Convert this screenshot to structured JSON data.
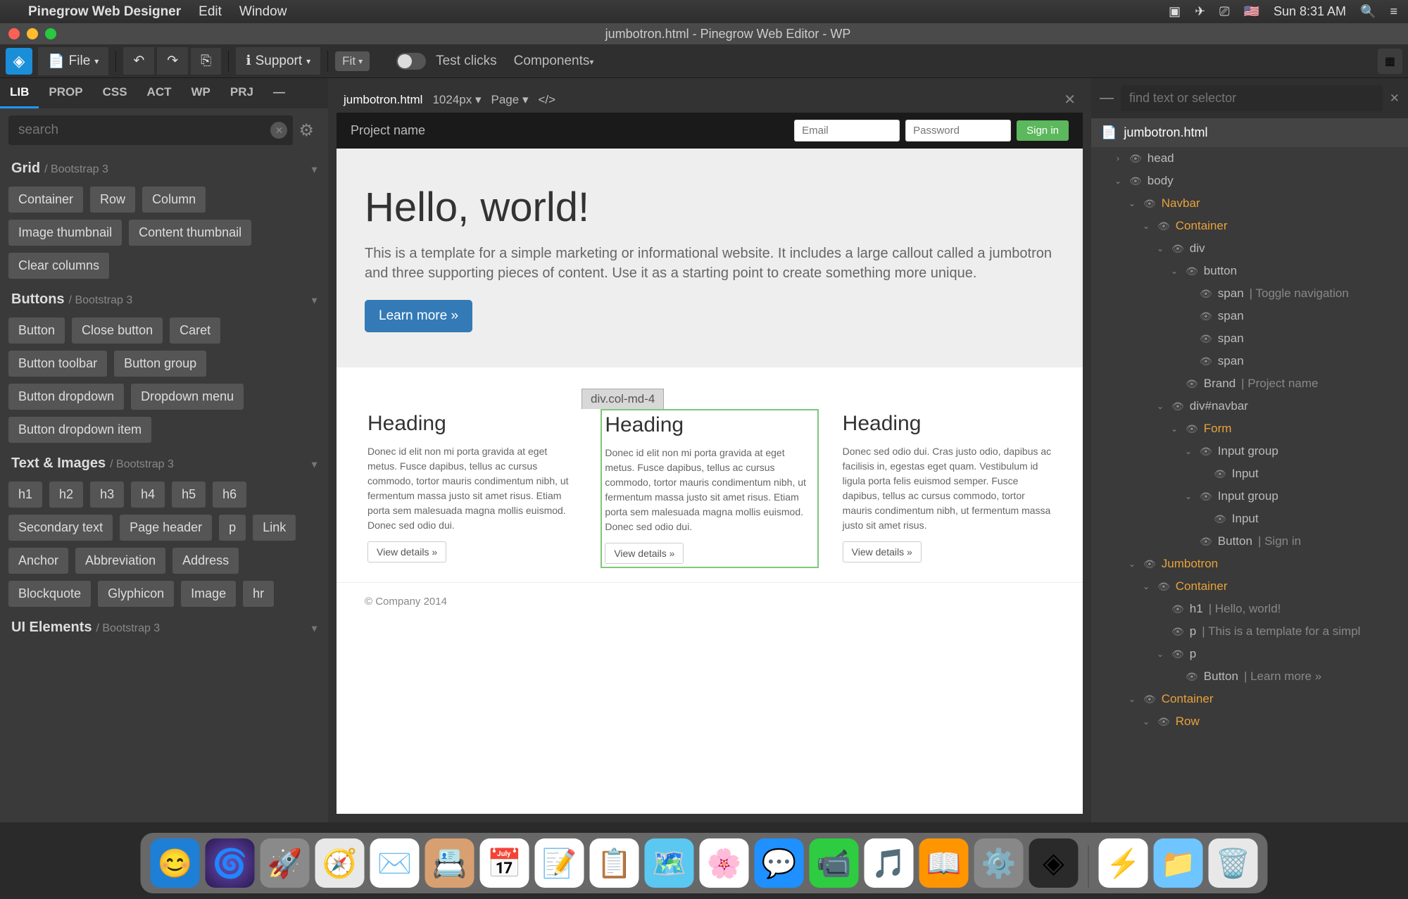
{
  "menubar": {
    "app": "Pinegrow Web Designer",
    "items": [
      "Edit",
      "Window"
    ],
    "clock": "Sun 8:31 AM"
  },
  "window": {
    "title": "jumbotron.html - Pinegrow Web Editor - WP"
  },
  "toolbar": {
    "file": "File",
    "support": "Support",
    "zoom": "Fit",
    "test_clicks": "Test clicks",
    "components": "Components"
  },
  "left": {
    "tabs": [
      "LIB",
      "PROP",
      "CSS",
      "ACT",
      "WP",
      "PRJ",
      "—"
    ],
    "search_placeholder": "search",
    "sections": [
      {
        "title": "Grid",
        "sub": "/ Bootstrap 3",
        "chips": [
          "Container",
          "Row",
          "Column",
          "Image thumbnail",
          "Content thumbnail",
          "Clear columns"
        ]
      },
      {
        "title": "Buttons",
        "sub": "/ Bootstrap 3",
        "chips": [
          "Button",
          "Close button",
          "Caret",
          "Button toolbar",
          "Button group",
          "Button dropdown",
          "Dropdown menu",
          "Button dropdown item"
        ]
      },
      {
        "title": "Text & Images",
        "sub": "/ Bootstrap 3",
        "chips": [
          "h1",
          "h2",
          "h3",
          "h4",
          "h5",
          "h6",
          "Secondary text",
          "Page header",
          "p",
          "Link",
          "Anchor",
          "Abbreviation",
          "Address",
          "Blockquote",
          "Glyphicon",
          "Image",
          "hr"
        ]
      },
      {
        "title": "UI Elements",
        "sub": "/ Bootstrap 3",
        "chips": []
      }
    ]
  },
  "canvas": {
    "file": "jumbotron.html",
    "size": "1024px",
    "page_menu": "Page",
    "selected_tag": "div.col-md-4"
  },
  "preview": {
    "project_name": "Project name",
    "email_ph": "Email",
    "password_ph": "Password",
    "signin": "Sign in",
    "jumbo_h1": "Hello, world!",
    "jumbo_p": "This is a template for a simple marketing or informational website. It includes a large callout called a jumbotron and three supporting pieces of content. Use it as a starting point to create something more unique.",
    "learn_more": "Learn more »",
    "cols": [
      {
        "h": "Heading",
        "p": "Donec id elit non mi porta gravida at eget metus. Fusce dapibus, tellus ac cursus commodo, tortor mauris condimentum nibh, ut fermentum massa justo sit amet risus. Etiam porta sem malesuada magna mollis euismod. Donec sed odio dui.",
        "btn": "View details »"
      },
      {
        "h": "Heading",
        "p": "Donec id elit non mi porta gravida at eget metus. Fusce dapibus, tellus ac cursus commodo, tortor mauris condimentum nibh, ut fermentum massa justo sit amet risus. Etiam porta sem malesuada magna mollis euismod. Donec sed odio dui.",
        "btn": "View details »"
      },
      {
        "h": "Heading",
        "p": "Donec sed odio dui. Cras justo odio, dapibus ac facilisis in, egestas eget quam. Vestibulum id ligula porta felis euismod semper. Fusce dapibus, tellus ac cursus commodo, tortor mauris condimentum nibh, ut fermentum massa justo sit amet risus.",
        "btn": "View details »"
      }
    ],
    "footer": "© Company 2014"
  },
  "tree": {
    "find_ph": "find text or selector",
    "file": "jumbotron.html",
    "rows": [
      {
        "ind": 1,
        "tw": "›",
        "tag": "head",
        "hl": false
      },
      {
        "ind": 1,
        "tw": "⌄",
        "tag": "body",
        "hl": false
      },
      {
        "ind": 2,
        "tw": "⌄",
        "tag": "Navbar",
        "hl": true
      },
      {
        "ind": 3,
        "tw": "⌄",
        "tag": "Container",
        "hl": true
      },
      {
        "ind": 4,
        "tw": "⌄",
        "tag": "div",
        "hl": false
      },
      {
        "ind": 5,
        "tw": "⌄",
        "tag": "button",
        "hl": false
      },
      {
        "ind": 6,
        "tw": "",
        "tag": "span",
        "hl": false,
        "extra": "| Toggle navigation"
      },
      {
        "ind": 6,
        "tw": "",
        "tag": "span",
        "hl": false
      },
      {
        "ind": 6,
        "tw": "",
        "tag": "span",
        "hl": false
      },
      {
        "ind": 6,
        "tw": "",
        "tag": "span",
        "hl": false
      },
      {
        "ind": 5,
        "tw": "",
        "tag": "Brand",
        "hl": false,
        "extra": "| Project name"
      },
      {
        "ind": 4,
        "tw": "⌄",
        "tag": "div#navbar",
        "hl": false
      },
      {
        "ind": 5,
        "tw": "⌄",
        "tag": "Form",
        "hl": true
      },
      {
        "ind": 6,
        "tw": "⌄",
        "tag": "Input group",
        "hl": false
      },
      {
        "ind": 7,
        "tw": "",
        "tag": "Input",
        "hl": false
      },
      {
        "ind": 6,
        "tw": "⌄",
        "tag": "Input group",
        "hl": false
      },
      {
        "ind": 7,
        "tw": "",
        "tag": "Input",
        "hl": false
      },
      {
        "ind": 6,
        "tw": "",
        "tag": "Button",
        "hl": false,
        "extra": "| Sign in"
      },
      {
        "ind": 2,
        "tw": "⌄",
        "tag": "Jumbotron",
        "hl": true
      },
      {
        "ind": 3,
        "tw": "⌄",
        "tag": "Container",
        "hl": true
      },
      {
        "ind": 4,
        "tw": "",
        "tag": "h1",
        "hl": false,
        "extra": "| Hello, world!"
      },
      {
        "ind": 4,
        "tw": "",
        "tag": "p",
        "hl": false,
        "extra": "| This is a template for a simpl"
      },
      {
        "ind": 4,
        "tw": "⌄",
        "tag": "p",
        "hl": false
      },
      {
        "ind": 5,
        "tw": "",
        "tag": "Button",
        "hl": false,
        "extra": "| Learn more »"
      },
      {
        "ind": 2,
        "tw": "⌄",
        "tag": "Container",
        "hl": true
      },
      {
        "ind": 3,
        "tw": "⌄",
        "tag": "Row",
        "hl": true
      }
    ]
  }
}
